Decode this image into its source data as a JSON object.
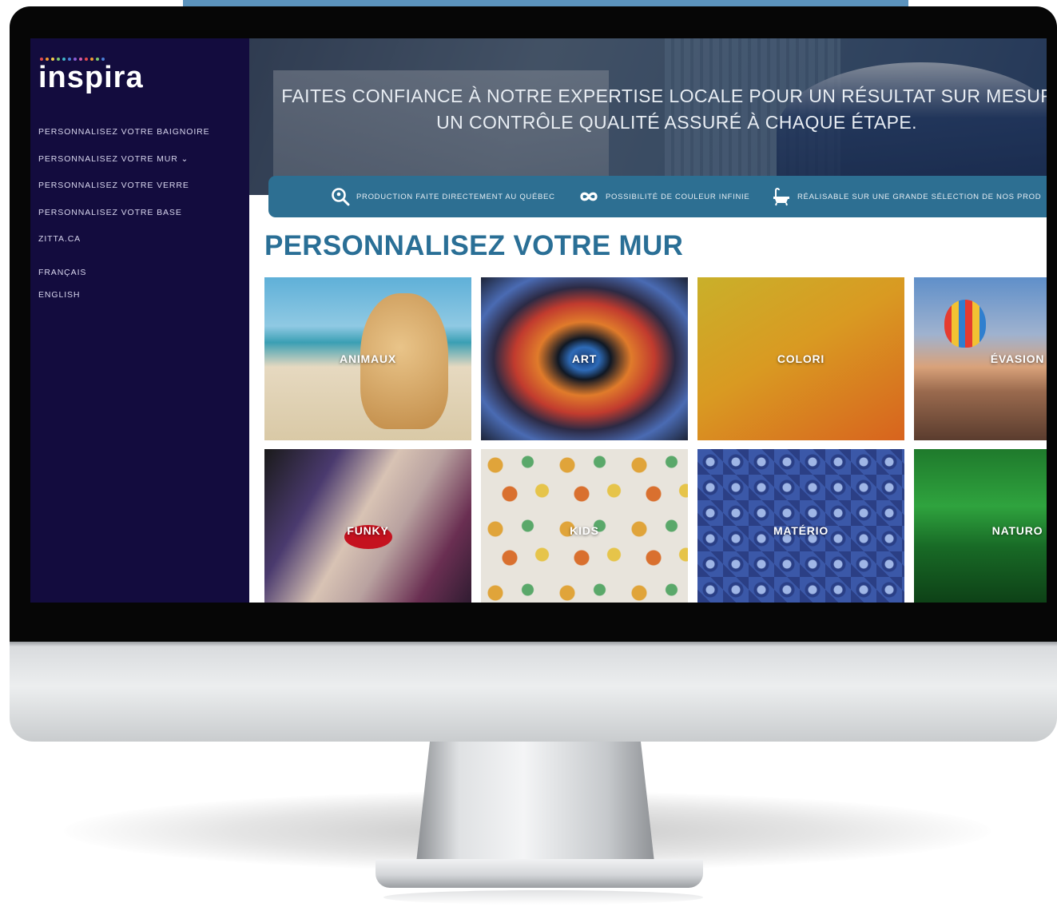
{
  "logo": {
    "text": "inspira",
    "dot_colors": [
      "#e64b4b",
      "#f39c33",
      "#f6d04d",
      "#7bc96f",
      "#3fb6c9",
      "#4a7fd6",
      "#8b5cd6",
      "#d65ca8",
      "#e64b4b",
      "#f39c33",
      "#7bc96f",
      "#4a7fd6"
    ]
  },
  "sidebar": {
    "menu": [
      {
        "label": "PERSONNALISEZ VOTRE BAIGNOIRE"
      },
      {
        "label": "PERSONNALISEZ VOTRE MUR ⌄"
      },
      {
        "label": "PERSONNALISEZ VOTRE VERRE"
      },
      {
        "label": "PERSONNALISEZ VOTRE BASE"
      },
      {
        "label": "ZITTA.CA"
      }
    ],
    "languages": [
      {
        "label": "FRANÇAIS"
      },
      {
        "label": "ENGLISH"
      }
    ]
  },
  "hero": {
    "line1": "FAITES CONFIANCE À NOTRE EXPERTISE LOCALE POUR UN RÉSULTAT SUR MESURE,",
    "line2": "UN CONTRÔLE QUALITÉ ASSURÉ À CHAQUE ÉTAPE."
  },
  "features": [
    {
      "icon": "location-search-icon",
      "text": "PRODUCTION FAITE DIRECTEMENT AU QUÉBEC"
    },
    {
      "icon": "infinity-icon",
      "text": "POSSIBILITÉ DE COULEUR INFINIE"
    },
    {
      "icon": "bathtub-icon",
      "text": "RÉALISABLE SUR UNE GRANDE SÉLECTION DE NOS PROD"
    }
  ],
  "page": {
    "title": "PERSONNALISEZ VOTRE MUR"
  },
  "categories": [
    {
      "label": "ANIMAUX"
    },
    {
      "label": "ART"
    },
    {
      "label": "COLORI"
    },
    {
      "label": "ÉVASION"
    },
    {
      "label": "FUNKY"
    },
    {
      "label": "KIDS"
    },
    {
      "label": "MATÉRIO"
    },
    {
      "label": "NATURO"
    }
  ],
  "colors": {
    "sidebar_bg": "#130c3e",
    "accent_blue": "#2a6f96",
    "feature_bar": "#2d6f92"
  }
}
